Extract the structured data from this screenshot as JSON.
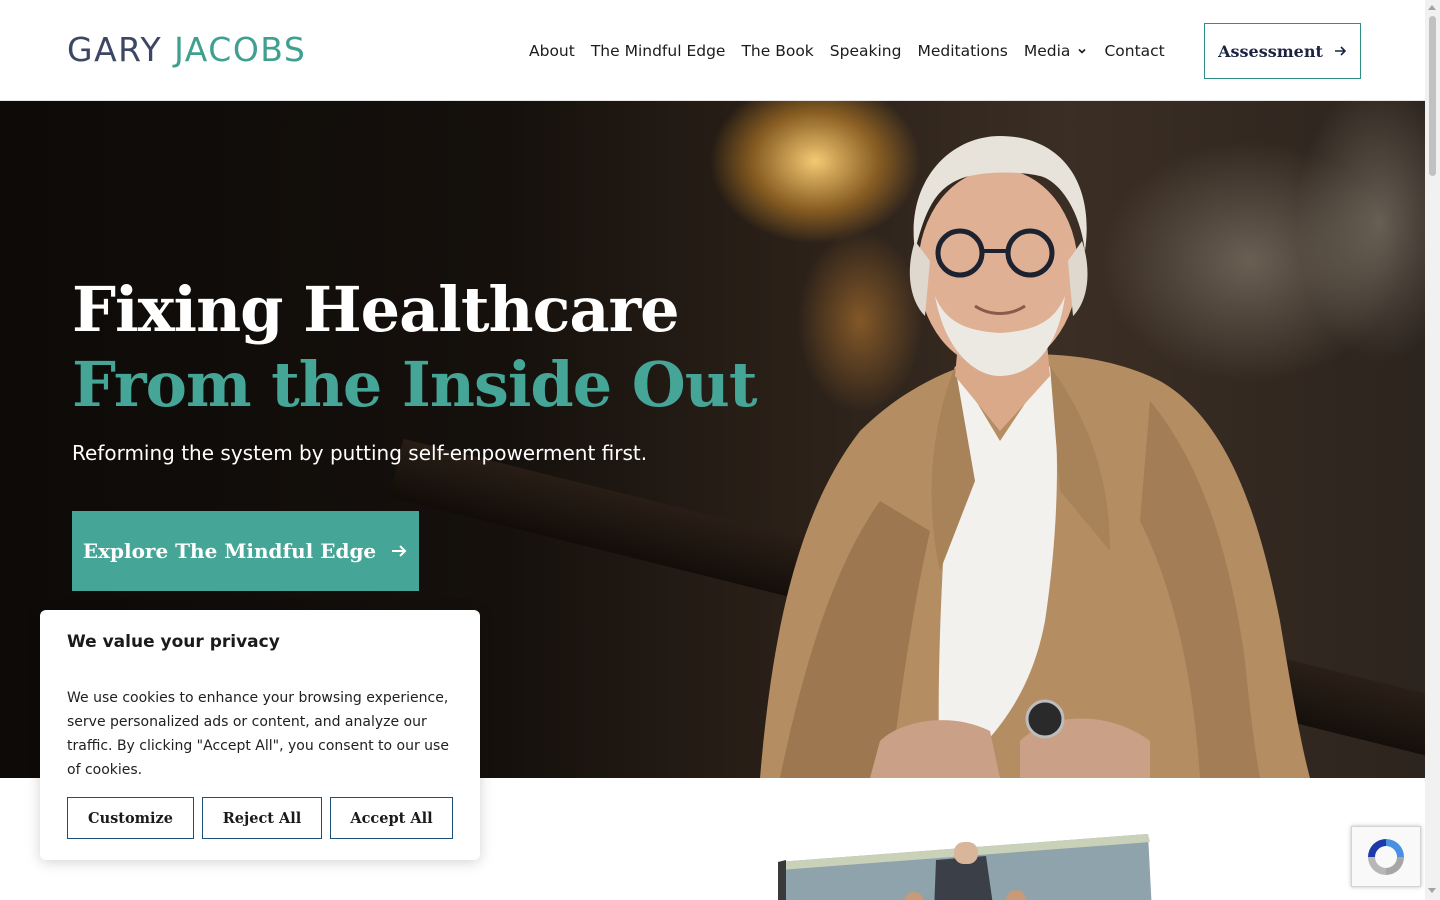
{
  "header": {
    "logo_first": "GARY",
    "logo_last": "JACOBS",
    "nav": [
      {
        "label": "About"
      },
      {
        "label": "The Mindful Edge"
      },
      {
        "label": "The Book"
      },
      {
        "label": "Speaking"
      },
      {
        "label": "Meditations"
      },
      {
        "label": "Media",
        "has_dropdown": true
      },
      {
        "label": "Contact"
      }
    ],
    "cta_label": "Assessment"
  },
  "hero": {
    "title_line1": "Fixing Healthcare",
    "title_line2": "From the Inside Out",
    "subtitle": "Reforming the system by putting self-empowerment first.",
    "cta_label": "Explore The Mindful Edge"
  },
  "cookie_banner": {
    "title": "We value your privacy",
    "text": "We use cookies to enhance your browsing experience, serve personalized ads or content, and analyze our traffic. By clicking \"Accept All\", you consent to our use of cookies.",
    "buttons": {
      "customize": "Customize",
      "reject": "Reject All",
      "accept": "Accept All"
    }
  },
  "colors": {
    "brand_navy": "#3d4663",
    "brand_teal": "#45a596",
    "logo_teal": "#3f9f91"
  },
  "icons": [
    "arrow-right-icon",
    "chevron-down-icon",
    "recaptcha-icon"
  ]
}
